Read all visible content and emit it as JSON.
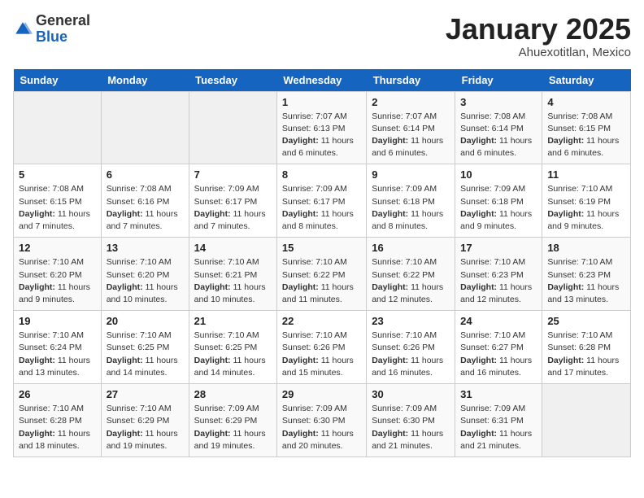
{
  "header": {
    "logo_general": "General",
    "logo_blue": "Blue",
    "title": "January 2025",
    "subtitle": "Ahuexotitlan, Mexico"
  },
  "weekdays": [
    "Sunday",
    "Monday",
    "Tuesday",
    "Wednesday",
    "Thursday",
    "Friday",
    "Saturday"
  ],
  "weeks": [
    [
      {
        "day": "",
        "info": ""
      },
      {
        "day": "",
        "info": ""
      },
      {
        "day": "",
        "info": ""
      },
      {
        "day": "1",
        "info": "Sunrise: 7:07 AM\nSunset: 6:13 PM\nDaylight: 11 hours and 6 minutes."
      },
      {
        "day": "2",
        "info": "Sunrise: 7:07 AM\nSunset: 6:14 PM\nDaylight: 11 hours and 6 minutes."
      },
      {
        "day": "3",
        "info": "Sunrise: 7:08 AM\nSunset: 6:14 PM\nDaylight: 11 hours and 6 minutes."
      },
      {
        "day": "4",
        "info": "Sunrise: 7:08 AM\nSunset: 6:15 PM\nDaylight: 11 hours and 6 minutes."
      }
    ],
    [
      {
        "day": "5",
        "info": "Sunrise: 7:08 AM\nSunset: 6:15 PM\nDaylight: 11 hours and 7 minutes."
      },
      {
        "day": "6",
        "info": "Sunrise: 7:08 AM\nSunset: 6:16 PM\nDaylight: 11 hours and 7 minutes."
      },
      {
        "day": "7",
        "info": "Sunrise: 7:09 AM\nSunset: 6:17 PM\nDaylight: 11 hours and 7 minutes."
      },
      {
        "day": "8",
        "info": "Sunrise: 7:09 AM\nSunset: 6:17 PM\nDaylight: 11 hours and 8 minutes."
      },
      {
        "day": "9",
        "info": "Sunrise: 7:09 AM\nSunset: 6:18 PM\nDaylight: 11 hours and 8 minutes."
      },
      {
        "day": "10",
        "info": "Sunrise: 7:09 AM\nSunset: 6:18 PM\nDaylight: 11 hours and 9 minutes."
      },
      {
        "day": "11",
        "info": "Sunrise: 7:10 AM\nSunset: 6:19 PM\nDaylight: 11 hours and 9 minutes."
      }
    ],
    [
      {
        "day": "12",
        "info": "Sunrise: 7:10 AM\nSunset: 6:20 PM\nDaylight: 11 hours and 9 minutes."
      },
      {
        "day": "13",
        "info": "Sunrise: 7:10 AM\nSunset: 6:20 PM\nDaylight: 11 hours and 10 minutes."
      },
      {
        "day": "14",
        "info": "Sunrise: 7:10 AM\nSunset: 6:21 PM\nDaylight: 11 hours and 10 minutes."
      },
      {
        "day": "15",
        "info": "Sunrise: 7:10 AM\nSunset: 6:22 PM\nDaylight: 11 hours and 11 minutes."
      },
      {
        "day": "16",
        "info": "Sunrise: 7:10 AM\nSunset: 6:22 PM\nDaylight: 11 hours and 12 minutes."
      },
      {
        "day": "17",
        "info": "Sunrise: 7:10 AM\nSunset: 6:23 PM\nDaylight: 11 hours and 12 minutes."
      },
      {
        "day": "18",
        "info": "Sunrise: 7:10 AM\nSunset: 6:23 PM\nDaylight: 11 hours and 13 minutes."
      }
    ],
    [
      {
        "day": "19",
        "info": "Sunrise: 7:10 AM\nSunset: 6:24 PM\nDaylight: 11 hours and 13 minutes."
      },
      {
        "day": "20",
        "info": "Sunrise: 7:10 AM\nSunset: 6:25 PM\nDaylight: 11 hours and 14 minutes."
      },
      {
        "day": "21",
        "info": "Sunrise: 7:10 AM\nSunset: 6:25 PM\nDaylight: 11 hours and 14 minutes."
      },
      {
        "day": "22",
        "info": "Sunrise: 7:10 AM\nSunset: 6:26 PM\nDaylight: 11 hours and 15 minutes."
      },
      {
        "day": "23",
        "info": "Sunrise: 7:10 AM\nSunset: 6:26 PM\nDaylight: 11 hours and 16 minutes."
      },
      {
        "day": "24",
        "info": "Sunrise: 7:10 AM\nSunset: 6:27 PM\nDaylight: 11 hours and 16 minutes."
      },
      {
        "day": "25",
        "info": "Sunrise: 7:10 AM\nSunset: 6:28 PM\nDaylight: 11 hours and 17 minutes."
      }
    ],
    [
      {
        "day": "26",
        "info": "Sunrise: 7:10 AM\nSunset: 6:28 PM\nDaylight: 11 hours and 18 minutes."
      },
      {
        "day": "27",
        "info": "Sunrise: 7:10 AM\nSunset: 6:29 PM\nDaylight: 11 hours and 19 minutes."
      },
      {
        "day": "28",
        "info": "Sunrise: 7:09 AM\nSunset: 6:29 PM\nDaylight: 11 hours and 19 minutes."
      },
      {
        "day": "29",
        "info": "Sunrise: 7:09 AM\nSunset: 6:30 PM\nDaylight: 11 hours and 20 minutes."
      },
      {
        "day": "30",
        "info": "Sunrise: 7:09 AM\nSunset: 6:30 PM\nDaylight: 11 hours and 21 minutes."
      },
      {
        "day": "31",
        "info": "Sunrise: 7:09 AM\nSunset: 6:31 PM\nDaylight: 11 hours and 21 minutes."
      },
      {
        "day": "",
        "info": ""
      }
    ]
  ]
}
